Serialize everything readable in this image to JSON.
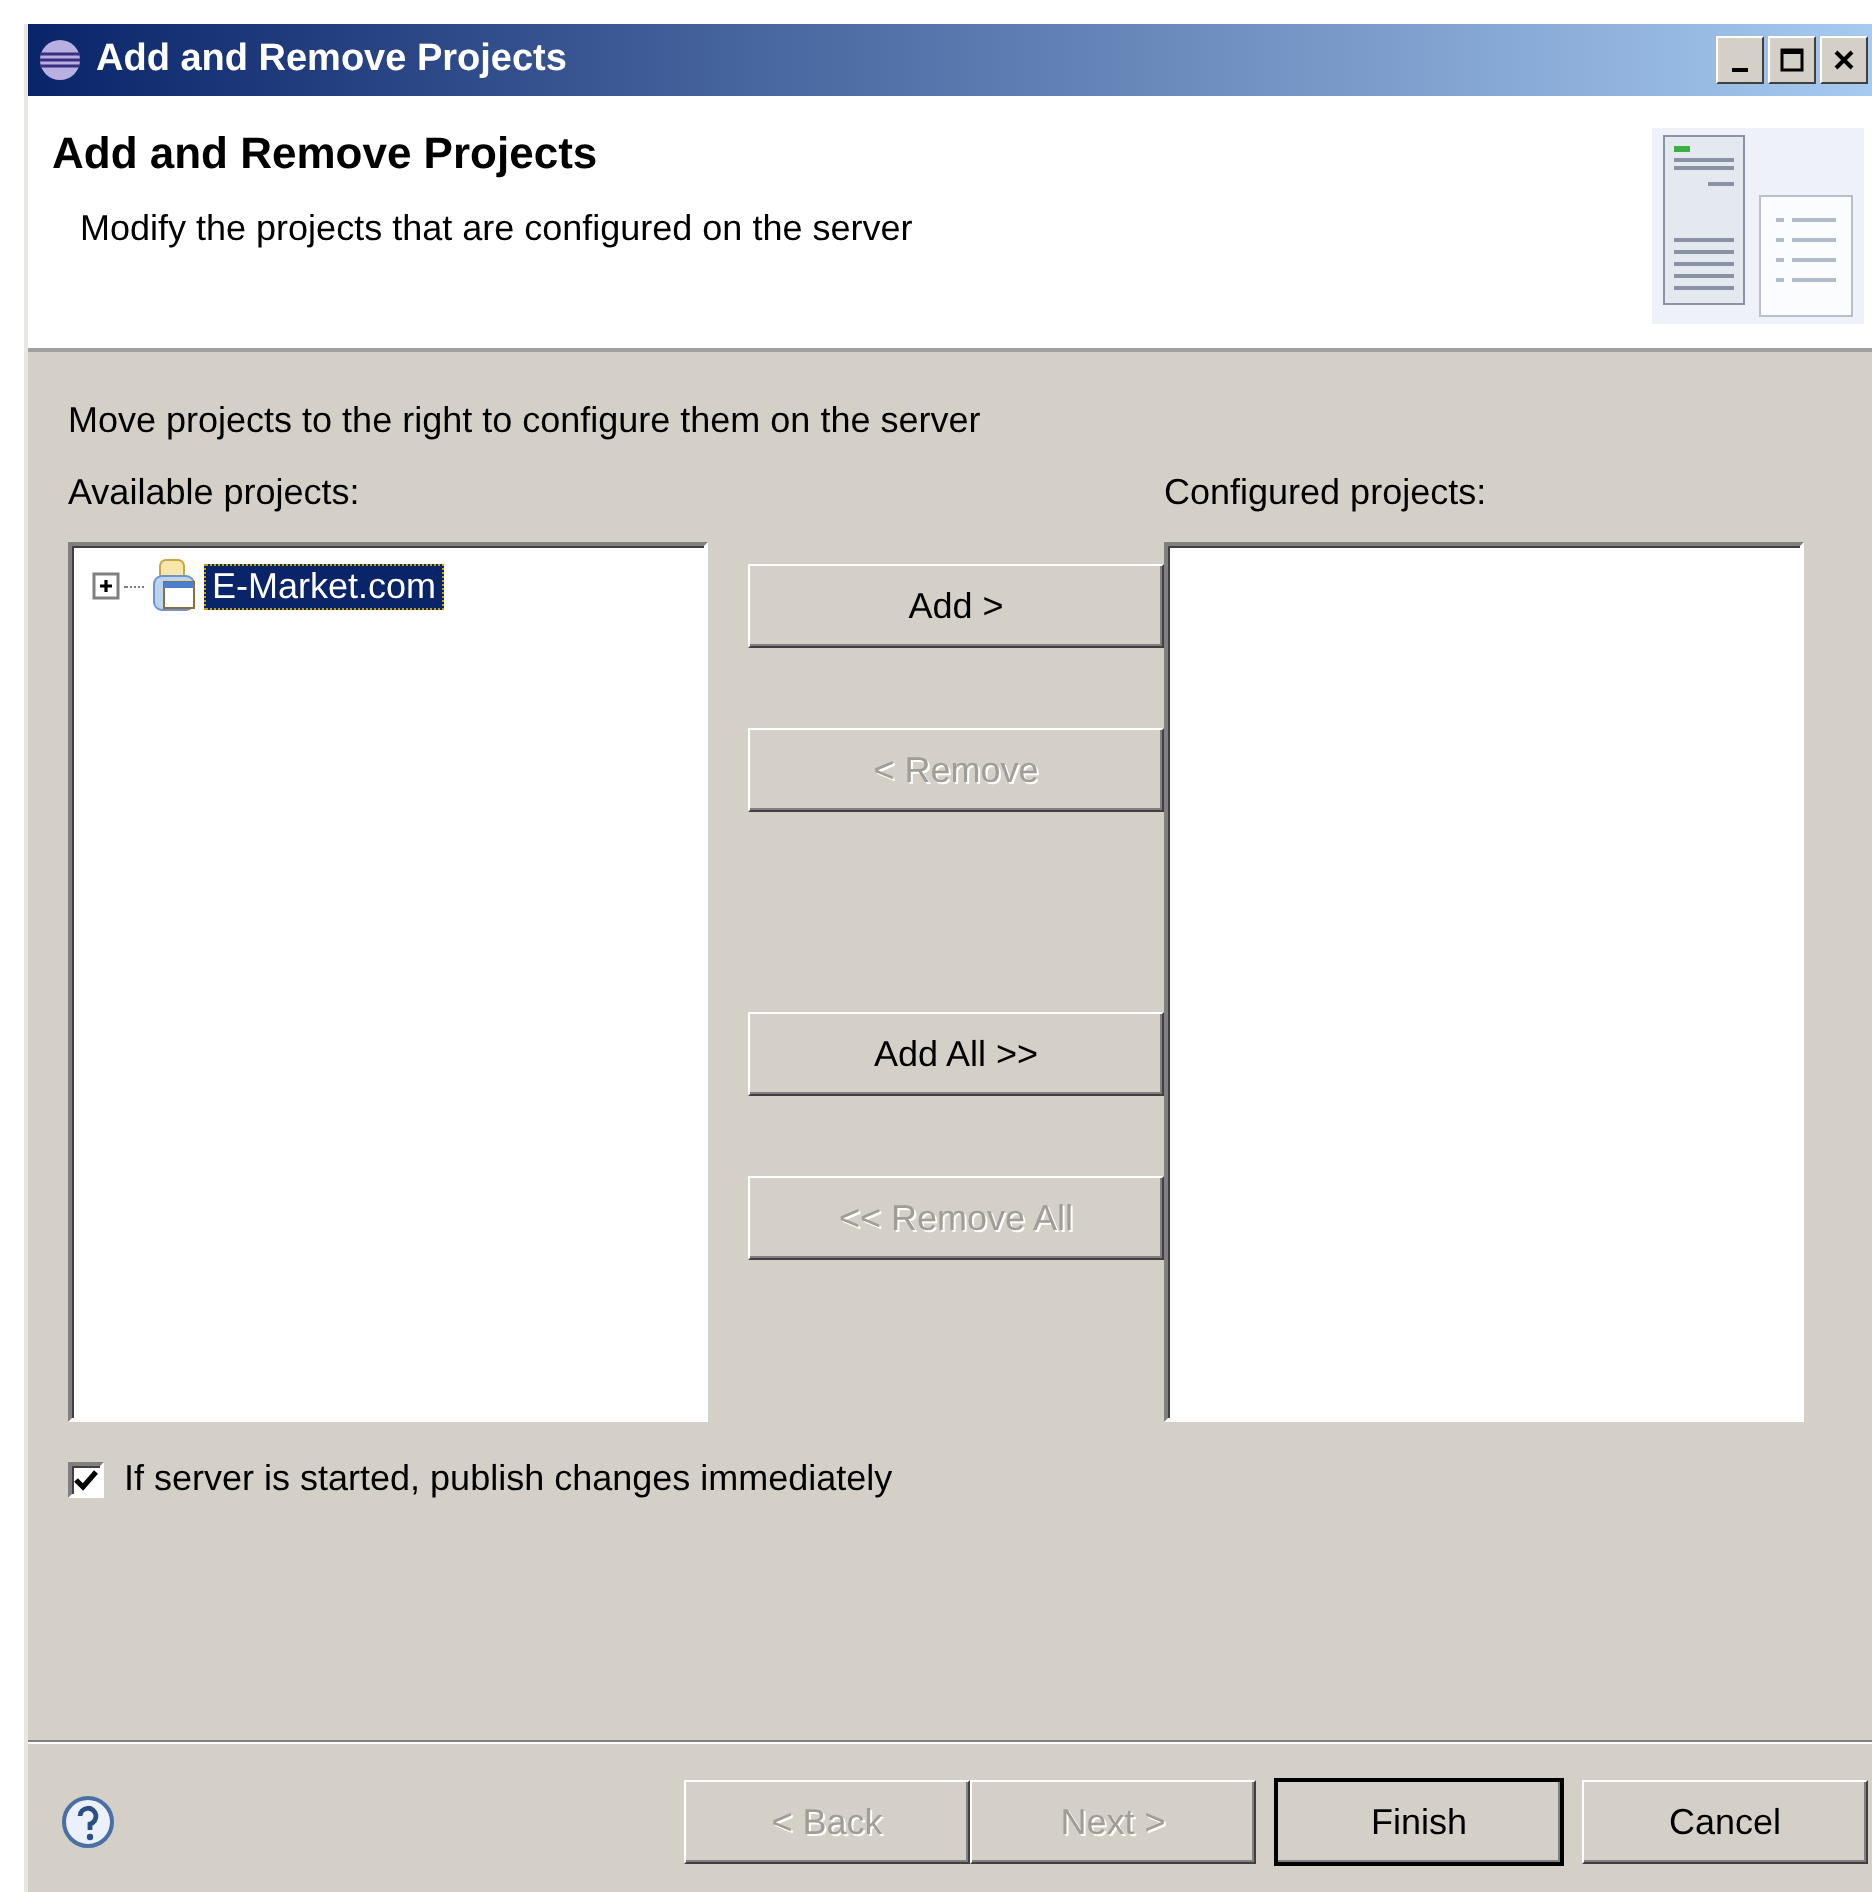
{
  "window": {
    "title": "Add and Remove Projects"
  },
  "header": {
    "title": "Add and Remove Projects",
    "description": "Modify the projects that are configured on the server"
  },
  "instruction": "Move projects to the right to configure them on the server",
  "available": {
    "label": "Available projects:",
    "items": [
      {
        "label": "E-Market.com",
        "expanded": false,
        "selected": true
      }
    ]
  },
  "move_buttons": [
    {
      "label": "Add >",
      "disabled": false
    },
    {
      "label": "< Remove",
      "disabled": true
    },
    {
      "label": "Add All >>",
      "disabled": false
    },
    {
      "label": "<< Remove All",
      "disabled": true
    }
  ],
  "configured": {
    "label": "Configured projects:"
  },
  "publish_option": {
    "label": "If server is started, publish changes immediately",
    "checked": true
  },
  "footer_buttons": [
    {
      "label": "< Back",
      "disabled": true,
      "default": false
    },
    {
      "label": "Next >",
      "disabled": true,
      "default": false
    },
    {
      "label": "Finish",
      "disabled": false,
      "default": true
    },
    {
      "label": "Cancel",
      "disabled": false,
      "default": false
    }
  ]
}
